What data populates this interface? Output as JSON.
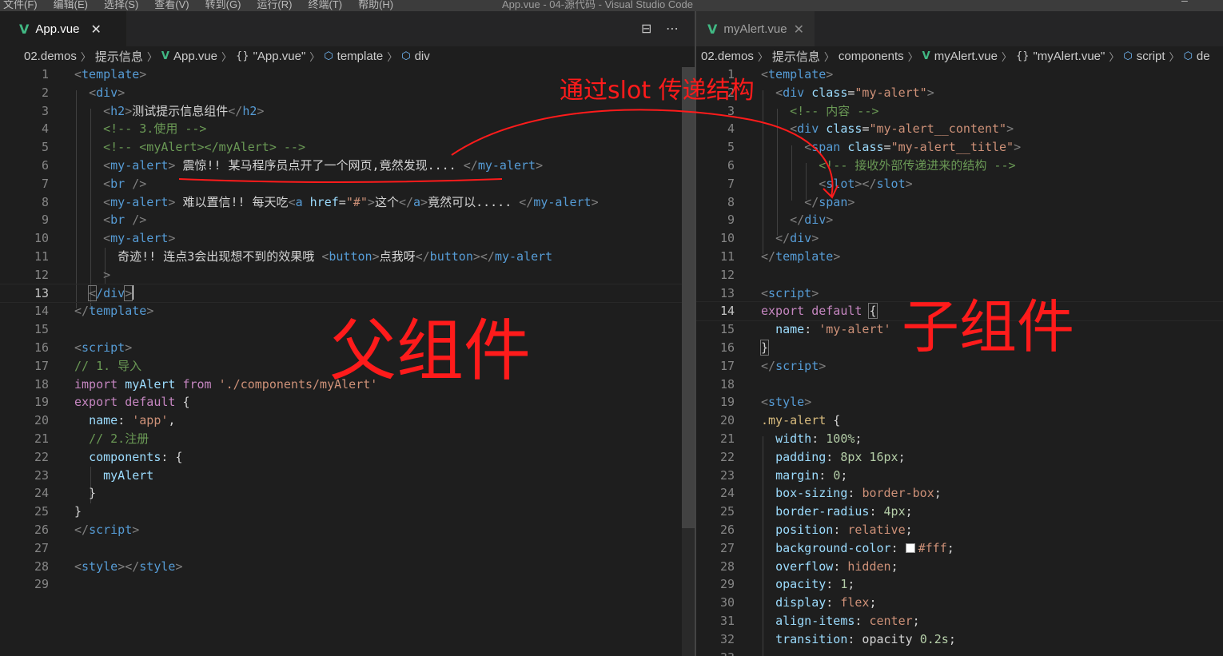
{
  "titlebar": {
    "menu": [
      "文件(F)",
      "编辑(E)",
      "选择(S)",
      "查看(V)",
      "转到(G)",
      "运行(R)",
      "终端(T)",
      "帮助(H)"
    ],
    "window_title": "App.vue - 04-源代码 - Visual Studio Code"
  },
  "left": {
    "tab": {
      "label": "App.vue",
      "close": "✕"
    },
    "actions": {
      "split": "⊟",
      "more": "⋯"
    },
    "breadcrumbs": [
      "02.demos",
      "提示信息",
      "App.vue",
      "\"App.vue\"",
      "template",
      "div"
    ],
    "current_line": 13
  },
  "right": {
    "tab": {
      "label": "myAlert.vue",
      "close": "✕"
    },
    "breadcrumbs": [
      "02.demos",
      "提示信息",
      "components",
      "myAlert.vue",
      "\"myAlert.vue\"",
      "script",
      "de"
    ],
    "current_line": 14
  },
  "annotations": {
    "parent": "父组件",
    "child": "子组件",
    "slot": "通过slot 传递结构"
  },
  "colors": {
    "background": "#1e1e1e",
    "annotation": "#ff1b1b",
    "vue_icon": "#41b883"
  },
  "icons": [
    "vue-file-icon",
    "split-editor-icon",
    "more-actions-icon",
    "close-icon",
    "braces-icon",
    "cube-icon",
    "chevron-right-icon"
  ]
}
